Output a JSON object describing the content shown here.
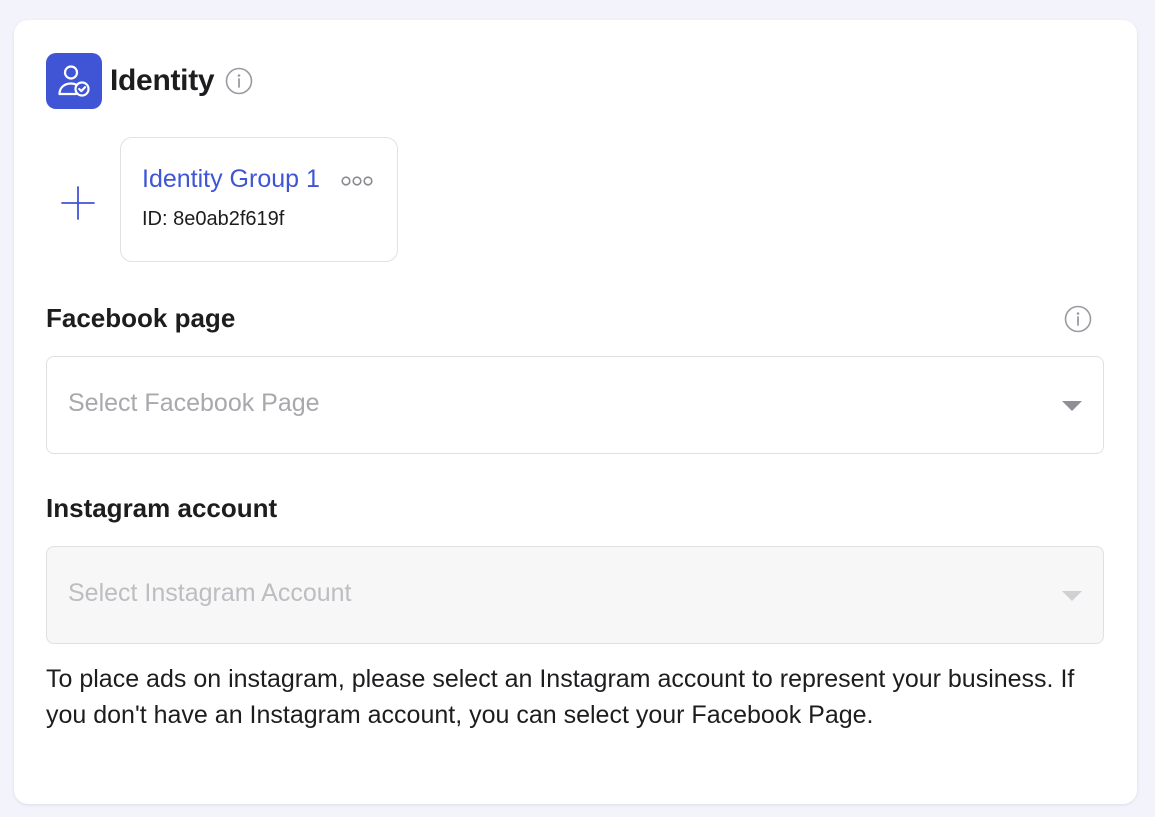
{
  "identity": {
    "title": "Identity",
    "header_icon": "user-check-icon",
    "info_icon": "info-icon",
    "accent_color": "#3f55d6"
  },
  "add_button": {
    "icon": "plus-icon"
  },
  "identity_group": {
    "name": "Identity Group 1",
    "id_text": "ID: 8e0ab2f619f",
    "more_icon": "more-dots-icon"
  },
  "facebook_page": {
    "label": "Facebook page",
    "placeholder": "Select Facebook Page",
    "info_icon": "info-icon"
  },
  "instagram_account": {
    "label": "Instagram account",
    "placeholder": "Select Instagram Account",
    "disabled": true,
    "help_text": "To place ads on instagram, please select an Instagram account to represent your business. If you don't have an Instagram account, you can select your Facebook Page."
  }
}
